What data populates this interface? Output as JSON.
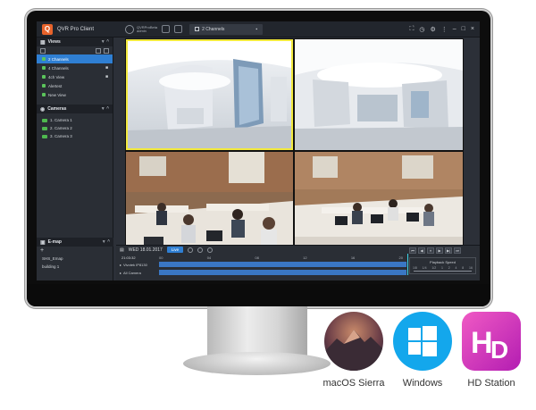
{
  "app": {
    "title": "QVR Pro Client",
    "account_line1": "QVRProBeta",
    "account_line2": "admin",
    "channel_selector": "2 Channels"
  },
  "sidebar": {
    "views_title": "Views",
    "view_items": [
      {
        "label": "2 Channels",
        "selected": true,
        "locked": false
      },
      {
        "label": "4 Channels",
        "selected": false,
        "locked": true
      },
      {
        "label": "4ch View",
        "selected": false,
        "locked": true
      },
      {
        "label": "Alertest",
        "selected": false,
        "locked": false
      },
      {
        "label": "New View",
        "selected": false,
        "locked": false
      }
    ],
    "cameras_title": "Cameras",
    "camera_items": [
      {
        "label": "1. Camera 1"
      },
      {
        "label": "2. Camera 2"
      },
      {
        "label": "3. Camera 3"
      }
    ],
    "emap_title": "E-map",
    "emap_items": [
      {
        "label": "SHS_Emap"
      },
      {
        "label": "building 1"
      }
    ]
  },
  "playback": {
    "date": "WED 18.01.2017",
    "live_label": "Live",
    "time": "21:03:32",
    "ruler_ticks": [
      "00",
      "04",
      "08",
      "12",
      "16",
      "20"
    ],
    "tracks": [
      {
        "label": "Vivotek IP8130"
      },
      {
        "label": "All Camera"
      }
    ],
    "speed_title": "Playback Speed",
    "speed_scale": [
      "1/8",
      "1/4",
      "1/2",
      "1",
      "2",
      "4",
      "8",
      "16"
    ]
  },
  "os": [
    {
      "label": "macOS Sierra"
    },
    {
      "label": "Windows"
    },
    {
      "label": "HD Station"
    }
  ],
  "colors": {
    "accent": "#2f7fd3",
    "selection_border": "#f2e93d",
    "brand_orange": "#e8632b"
  }
}
